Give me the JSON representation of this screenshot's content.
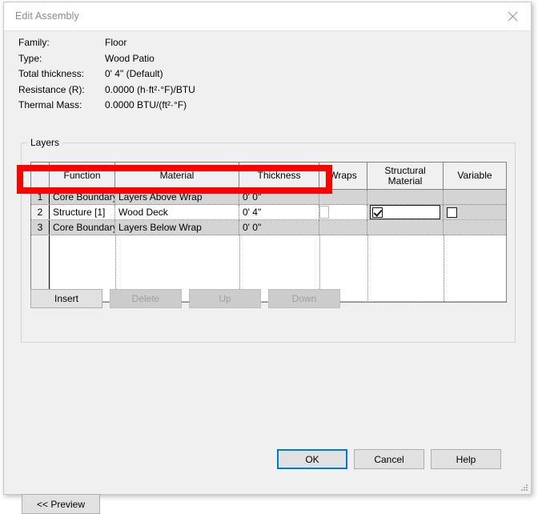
{
  "window": {
    "title": "Edit Assembly",
    "close_icon": "close-icon"
  },
  "properties": [
    {
      "label": "Family:",
      "value": "Floor"
    },
    {
      "label": "Type:",
      "value": "Wood Patio"
    },
    {
      "label": "Total thickness:",
      "value": "0'  4\" (Default)"
    },
    {
      "label": "Resistance (R):",
      "value": "0.0000 (h·ft²·°F)/BTU"
    },
    {
      "label": "Thermal Mass:",
      "value": "0.0000 BTU/(ft²·°F)"
    }
  ],
  "layers": {
    "group_label": "Layers",
    "columns": [
      {
        "key": "num",
        "label": ""
      },
      {
        "key": "function",
        "label": "Function"
      },
      {
        "key": "material",
        "label": "Material"
      },
      {
        "key": "thickness",
        "label": "Thickness"
      },
      {
        "key": "wraps",
        "label": "Wraps"
      },
      {
        "key": "structural_material",
        "label": "Structural\nMaterial"
      },
      {
        "key": "variable",
        "label": "Variable"
      }
    ],
    "column_header_structural_line1": "Structural",
    "column_header_structural_line2": "Material",
    "rows": [
      {
        "num": "1",
        "function": "Core Boundary",
        "material": "Layers Above Wrap",
        "thickness": "0'  0\"",
        "wraps": "",
        "structural_material": "",
        "variable": "",
        "selected": false,
        "shaded": true
      },
      {
        "num": "2",
        "function": "Structure [1]",
        "material": "Wood Deck",
        "thickness": "0'  4\"",
        "wraps": "",
        "structural_material": "checked",
        "variable": "unchecked",
        "selected": true,
        "shaded": false
      },
      {
        "num": "3",
        "function": "Core Boundary",
        "material": "Layers Below Wrap",
        "thickness": "0'  0\"",
        "wraps": "",
        "structural_material": "",
        "variable": "",
        "selected": false,
        "shaded": true
      }
    ],
    "buttons": [
      {
        "label": "Insert",
        "enabled": true
      },
      {
        "label": "Delete",
        "enabled": false
      },
      {
        "label": "Up",
        "enabled": false
      },
      {
        "label": "Down",
        "enabled": false
      }
    ]
  },
  "footer": {
    "preview": "<< Preview",
    "ok": "OK",
    "cancel": "Cancel",
    "help": "Help"
  },
  "annotation": {
    "color": "#fd0000",
    "highlights_row": "2"
  }
}
